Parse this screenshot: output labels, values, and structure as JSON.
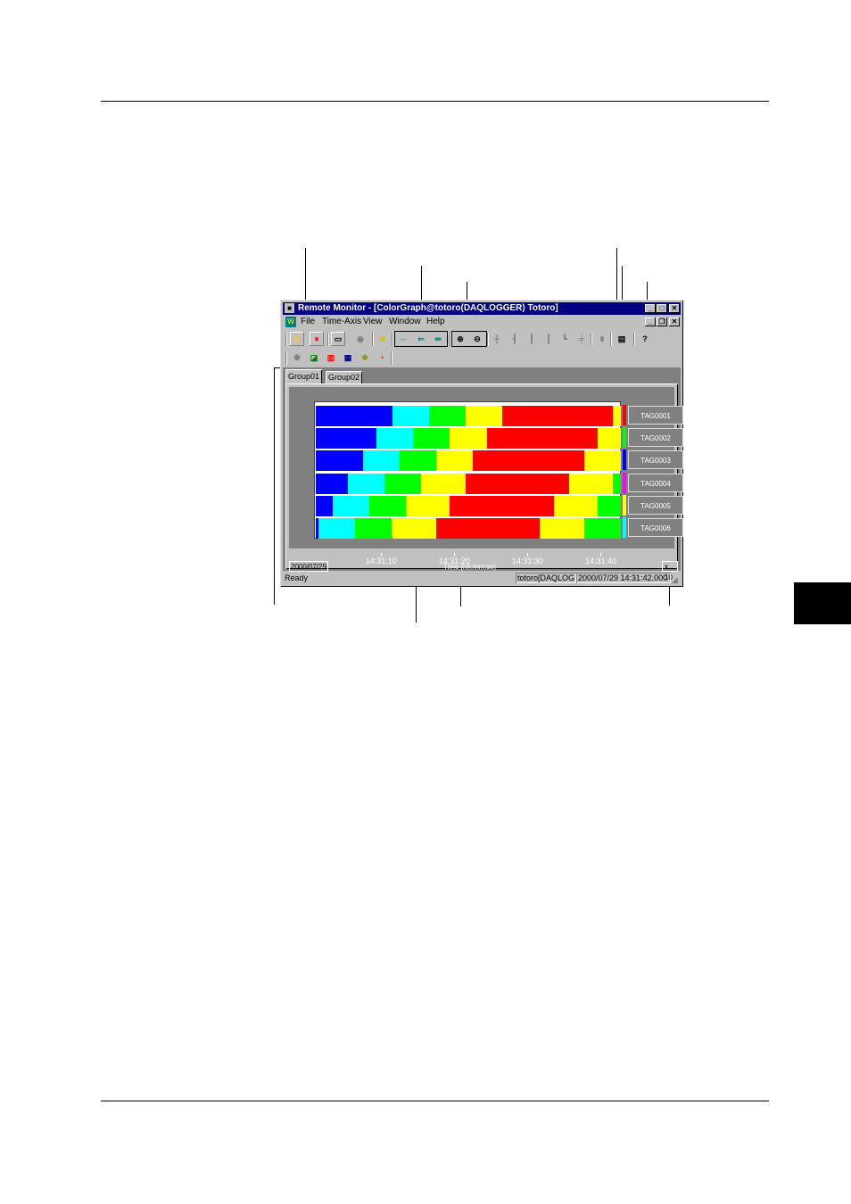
{
  "window": {
    "title": "Remote Monitor - [ColorGraph@totoro(DAQLOGGER) Totoro]",
    "title_icon": "computer-icon",
    "controls": [
      "_",
      "□",
      "✕"
    ]
  },
  "menu": {
    "items": [
      "File",
      "Time-Axis",
      "View",
      "Window",
      "Help"
    ],
    "mdi_controls": [
      "_",
      "❐",
      "✕"
    ]
  },
  "toolbar1": [
    {
      "name": "start-icon",
      "glyph": "⚡",
      "color": "#0000ff"
    },
    {
      "name": "stop-icon",
      "glyph": "⏸",
      "color": "#ff0000"
    },
    {
      "name": "alarm-icon",
      "glyph": "▭",
      "color": "#000000"
    },
    {
      "name": "settings-icon",
      "glyph": "◉",
      "color": "#808080"
    },
    {
      "name": "burst-icon",
      "glyph": "✸",
      "color": "#e0c000"
    },
    {
      "name": "time-axis-1-icon",
      "glyph": "⇔",
      "color": "#008080"
    },
    {
      "name": "time-axis-2-icon",
      "glyph": "⇐",
      "color": "#008080"
    },
    {
      "name": "time-axis-3-icon",
      "glyph": "⇚",
      "color": "#008080"
    },
    {
      "name": "zoom-in-icon",
      "glyph": "⊕",
      "color": "#000000"
    },
    {
      "name": "zoom-out-icon",
      "glyph": "⊖",
      "color": "#000000"
    },
    {
      "name": "cursor-1-icon",
      "glyph": "╫",
      "color": "#808080"
    },
    {
      "name": "cursor-2-icon",
      "glyph": "┨",
      "color": "#808080"
    },
    {
      "name": "cursor-3-icon",
      "glyph": "┃",
      "color": "#808080"
    },
    {
      "name": "cursor-4-icon",
      "glyph": "┃",
      "color": "#808080"
    },
    {
      "name": "cursor-5-icon",
      "glyph": "┗",
      "color": "#808080"
    },
    {
      "name": "cursor-6-icon",
      "glyph": "╪",
      "color": "#808080"
    },
    {
      "name": "scroll-icon",
      "glyph": "⇟",
      "color": "#808080"
    },
    {
      "name": "print-icon",
      "glyph": "▤",
      "color": "#000000"
    },
    {
      "name": "help-icon",
      "glyph": "?",
      "color": "#000000"
    }
  ],
  "toolbar2": [
    {
      "name": "gear-icon",
      "glyph": "✺",
      "color": "#808080"
    },
    {
      "name": "trend-graph-icon",
      "glyph": "◪",
      "color": "#008000"
    },
    {
      "name": "color-graph-icon",
      "glyph": "▥",
      "color": "#ff0000"
    },
    {
      "name": "digital-icon",
      "glyph": "▦",
      "color": "#000080"
    },
    {
      "name": "overview-icon",
      "glyph": "⁜",
      "color": "#808000"
    },
    {
      "name": "meter-icon",
      "glyph": "◔",
      "color": "#ff0000"
    }
  ],
  "tabs": [
    "Group01",
    "Group02"
  ],
  "chart_data": {
    "type": "bar",
    "x_range": [
      0,
      1
    ],
    "series": [
      {
        "name": "TAG0001",
        "marker_color": "#ff0000",
        "segments": [
          [
            "#0000ff",
            0,
            0.25
          ],
          [
            "#00ffff",
            0.25,
            0.37
          ],
          [
            "#00ff00",
            0.37,
            0.49
          ],
          [
            "#ffff00",
            0.49,
            0.61
          ],
          [
            "#ff0000",
            0.61,
            0.975
          ],
          [
            "#ffff00",
            0.975,
            1
          ]
        ]
      },
      {
        "name": "TAG0002",
        "marker_color": "#00ff00",
        "segments": [
          [
            "#0000ff",
            0,
            0.2
          ],
          [
            "#00ffff",
            0.2,
            0.32
          ],
          [
            "#00ff00",
            0.32,
            0.44
          ],
          [
            "#ffff00",
            0.44,
            0.56
          ],
          [
            "#ff0000",
            0.56,
            0.925
          ],
          [
            "#ffff00",
            0.925,
            1
          ]
        ]
      },
      {
        "name": "TAG0003",
        "marker_color": "#0000ff",
        "segments": [
          [
            "#0000ff",
            0,
            0.155
          ],
          [
            "#00ffff",
            0.155,
            0.275
          ],
          [
            "#00ff00",
            0.275,
            0.395
          ],
          [
            "#ffff00",
            0.395,
            0.515
          ],
          [
            "#ff0000",
            0.515,
            0.88
          ],
          [
            "#ffff00",
            0.88,
            1
          ]
        ]
      },
      {
        "name": "TAG0004",
        "marker_color": "#ff00ff",
        "segments": [
          [
            "#0000ff",
            0,
            0.105
          ],
          [
            "#00ffff",
            0.105,
            0.225
          ],
          [
            "#00ff00",
            0.225,
            0.345
          ],
          [
            "#ffff00",
            0.345,
            0.49
          ],
          [
            "#ff0000",
            0.49,
            0.83
          ],
          [
            "#ffff00",
            0.83,
            0.975
          ],
          [
            "#00ff00",
            0.975,
            1
          ]
        ]
      },
      {
        "name": "TAG0005",
        "marker_color": "#ffff00",
        "segments": [
          [
            "#0000ff",
            0,
            0.055
          ],
          [
            "#00ffff",
            0.055,
            0.175
          ],
          [
            "#00ff00",
            0.175,
            0.295
          ],
          [
            "#ffff00",
            0.295,
            0.44
          ],
          [
            "#ff0000",
            0.44,
            0.78
          ],
          [
            "#ffff00",
            0.78,
            0.925
          ],
          [
            "#00ff00",
            0.925,
            1
          ]
        ]
      },
      {
        "name": "TAG0006",
        "marker_color": "#00ffff",
        "segments": [
          [
            "#0000ff",
            0,
            0.01
          ],
          [
            "#00ffff",
            0.01,
            0.13
          ],
          [
            "#00ff00",
            0.13,
            0.25
          ],
          [
            "#ffff00",
            0.25,
            0.395
          ],
          [
            "#ff0000",
            0.395,
            0.735
          ],
          [
            "#ffff00",
            0.735,
            0.88
          ],
          [
            "#00ff00",
            0.88,
            1
          ]
        ]
      }
    ],
    "x_ticks": [
      {
        "label": "14:31:10",
        "x": 0.22
      },
      {
        "label": "14:31:20",
        "x": 0.46
      },
      {
        "label": "14:31:30",
        "x": 0.7
      },
      {
        "label": "14:31:40",
        "x": 0.94
      }
    ],
    "xlabel": "Time [hh:mm:ss]"
  },
  "chart_footer": {
    "date": "2000/07/29",
    "scale": "x 10"
  },
  "status": {
    "left": "Ready",
    "host": "totoro[DAQLOG",
    "datetime": "2000/07/29 14:31:42.000"
  }
}
